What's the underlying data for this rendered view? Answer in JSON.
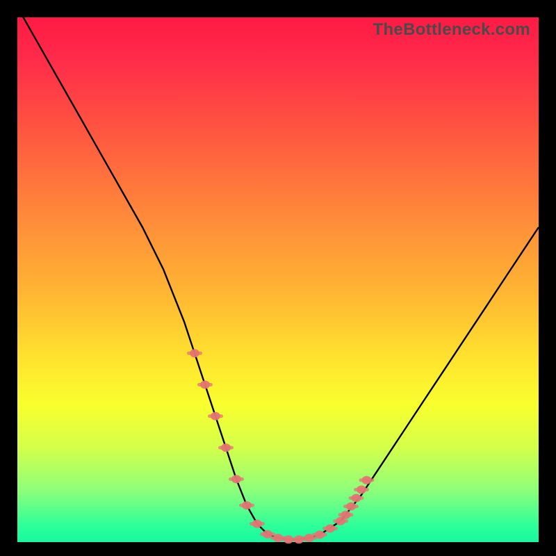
{
  "watermark": "TheBottleneck.com",
  "colors": {
    "frame_bg": "#000000",
    "curve_stroke": "#000000",
    "marker_fill": "#e57373",
    "gradient_top": "#ff1a44",
    "gradient_mid": "#ffe62e",
    "gradient_bottom": "#18f8a0"
  },
  "chart_data": {
    "type": "line",
    "title": "",
    "xlabel": "",
    "ylabel": "",
    "xlim": [
      0,
      100
    ],
    "ylim": [
      0,
      100
    ],
    "series": [
      {
        "name": "bottleneck-curve",
        "x": [
          0,
          4,
          8,
          12,
          16,
          20,
          24,
          28,
          30,
          32,
          34,
          36,
          38,
          40,
          42,
          44,
          46,
          48,
          50,
          52,
          54,
          56,
          58,
          62,
          66,
          70,
          74,
          78,
          82,
          86,
          90,
          94,
          100
        ],
        "y": [
          102,
          95,
          88,
          81,
          74,
          67,
          60,
          52,
          47,
          42,
          36,
          30,
          24,
          18,
          12,
          7,
          3.5,
          1.5,
          0.8,
          0.5,
          0.5,
          0.8,
          1.4,
          4,
          9,
          15,
          21,
          27,
          33,
          39,
          45,
          51,
          60
        ]
      }
    ],
    "markers": {
      "name": "highlighted-region",
      "x": [
        34,
        36,
        38,
        40,
        42,
        44,
        46,
        48,
        50,
        52,
        54,
        56,
        58,
        60,
        62,
        63,
        64,
        65,
        66,
        67
      ],
      "y": [
        36,
        30,
        24,
        18,
        12,
        7,
        3.5,
        1.5,
        0.8,
        0.5,
        0.5,
        0.8,
        1.4,
        2.6,
        4,
        5.2,
        6.8,
        8.4,
        10,
        11.8
      ]
    }
  }
}
